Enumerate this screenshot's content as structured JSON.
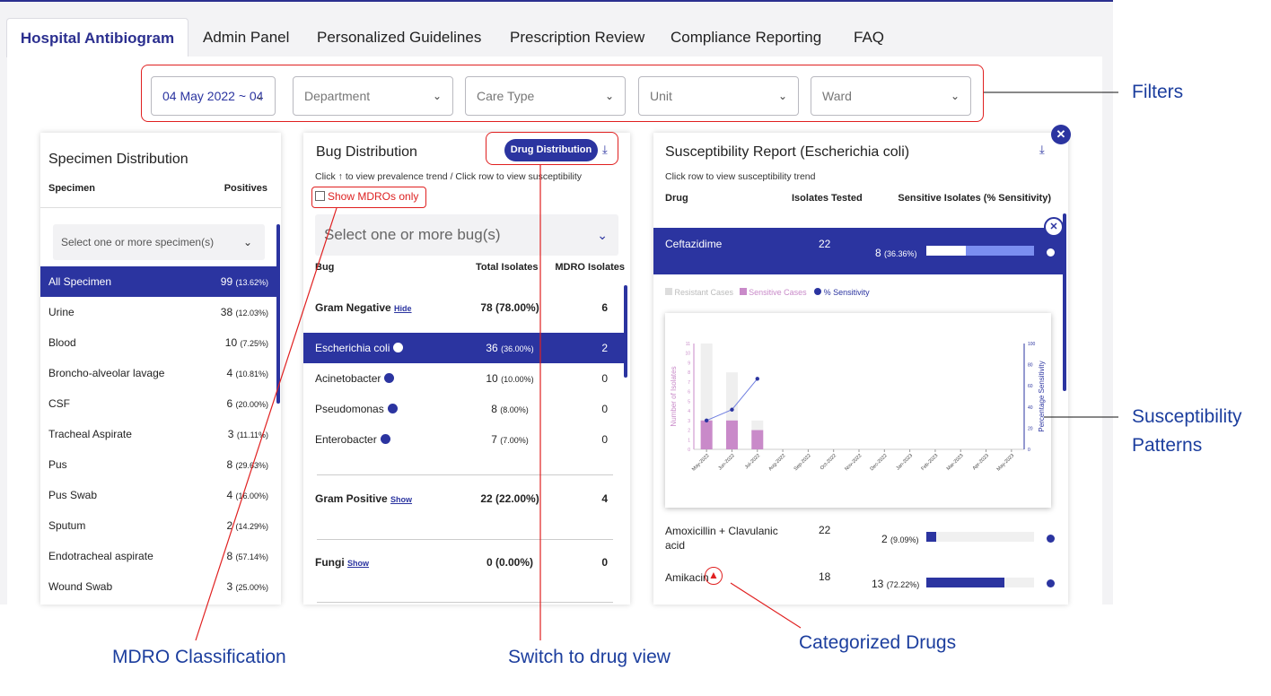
{
  "tabs": [
    "Hospital Antibiogram",
    "Admin Panel",
    "Personalized Guidelines",
    "Prescription Review",
    "Compliance Reporting",
    "FAQ"
  ],
  "filters": {
    "date": "04 May 2022 ~ 04",
    "department": "Department",
    "care_type": "Care Type",
    "unit": "Unit",
    "ward": "Ward"
  },
  "specimen": {
    "title": "Specimen Distribution",
    "col1": "Specimen",
    "col2": "Positives",
    "select": "Select one or more specimen(s)",
    "rows": [
      [
        "All Specimen",
        "99",
        "(13.62%)"
      ],
      [
        "Urine",
        "38",
        "(12.03%)"
      ],
      [
        "Blood",
        "10",
        "(7.25%)"
      ],
      [
        "Broncho-alveolar lavage",
        "4",
        "(10.81%)"
      ],
      [
        "CSF",
        "6",
        "(20.00%)"
      ],
      [
        "Tracheal Aspirate",
        "3",
        "(11.11%)"
      ],
      [
        "Pus",
        "8",
        "(29.63%)"
      ],
      [
        "Pus Swab",
        "4",
        "(16.00%)"
      ],
      [
        "Sputum",
        "2",
        "(14.29%)"
      ],
      [
        "Endotracheal aspirate",
        "8",
        "(57.14%)"
      ],
      [
        "Wound Swab",
        "3",
        "(25.00%)"
      ]
    ]
  },
  "bug": {
    "title": "Bug Distribution",
    "drug_btn": "Drug Distribution",
    "hint": "Click ↑ to view prevalence trend / Click row to view susceptibility",
    "mdro": "Show MDROs only",
    "select": "Select one or more bug(s)",
    "col1": "Bug",
    "col2": "Total Isolates",
    "col3": "MDRO Isolates",
    "gneg": {
      "label": "Gram Negative",
      "link": "Hide",
      "total": "78 (78.00%)",
      "mdro": "6"
    },
    "rows": [
      [
        "Escherichia coli",
        "36",
        "(36.00%)",
        "2"
      ],
      [
        "Acinetobacter",
        "10",
        "(10.00%)",
        "0"
      ],
      [
        "Pseudomonas",
        "8",
        "(8.00%)",
        "0"
      ],
      [
        "Enterobacter",
        "7",
        "(7.00%)",
        "0"
      ]
    ],
    "gpos": {
      "label": "Gram Positive",
      "link": "Show",
      "total": "22 (22.00%)",
      "mdro": "4"
    },
    "fungi": {
      "label": "Fungi",
      "link": "Show",
      "total": "0 (0.00%)",
      "mdro": "0"
    }
  },
  "sus": {
    "title": "Susceptibility Report (Escherichia coli)",
    "hint": "Click row to view susceptibility trend",
    "col1": "Drug",
    "col2": "Isolates Tested",
    "col3": "Sensitive Isolates (% Sensitivity)",
    "drugs": [
      {
        "name": "Ceftazidime",
        "tested": "22",
        "sens": "8",
        "pct": "(36.36%)",
        "frac": 0.3636
      },
      {
        "name": "Amoxicillin + Clavulanic acid",
        "tested": "22",
        "sens": "2",
        "pct": "(9.09%)",
        "frac": 0.0909
      },
      {
        "name": "Amikacin",
        "tested": "18",
        "sens": "13",
        "pct": "(72.22%)",
        "frac": 0.7222
      }
    ],
    "legend": [
      "Resistant Cases",
      "Sensitive Cases",
      "% Sensitivity"
    ]
  },
  "chart_data": {
    "type": "bar",
    "categories": [
      "May-2022",
      "Jun-2022",
      "Jul-2022",
      "Aug-2022",
      "Sep-2022",
      "Oct-2022",
      "Nov-2022",
      "Dec-2022",
      "Jan-2023",
      "Feb-2023",
      "Mar-2023",
      "Apr-2023",
      "May-2023"
    ],
    "series": [
      {
        "name": "Resistant Cases",
        "values": [
          8,
          5,
          1,
          0,
          0,
          0,
          0,
          0,
          0,
          0,
          0,
          0,
          0
        ]
      },
      {
        "name": "Sensitive Cases",
        "values": [
          3,
          3,
          2,
          0,
          0,
          0,
          0,
          0,
          0,
          0,
          0,
          0,
          0
        ]
      },
      {
        "name": "% Sensitivity",
        "values": [
          27.3,
          37.5,
          66.7,
          null,
          null,
          null,
          null,
          null,
          null,
          null,
          null,
          null,
          null
        ]
      }
    ],
    "ylabel": "Number of Isolates",
    "y2label": "Percentage Sensitivity",
    "ylim": [
      0,
      11
    ],
    "y2lim": [
      0,
      100
    ],
    "yticks": [
      "0",
      "1",
      "2",
      "3",
      "4",
      "5",
      "6",
      "7",
      "8",
      "9",
      "10",
      "11"
    ],
    "y2ticks": [
      "0",
      "20",
      "40",
      "60",
      "80",
      "100"
    ],
    "colors": [
      "#efefef",
      "#c98ac9",
      "#2b34a0"
    ]
  },
  "annotations": {
    "filters": "Filters",
    "sus1": "Susceptibility",
    "sus2": "Patterns",
    "mdro": "MDRO Classification",
    "switch": "Switch to drug view",
    "cat": "Categorized Drugs"
  }
}
